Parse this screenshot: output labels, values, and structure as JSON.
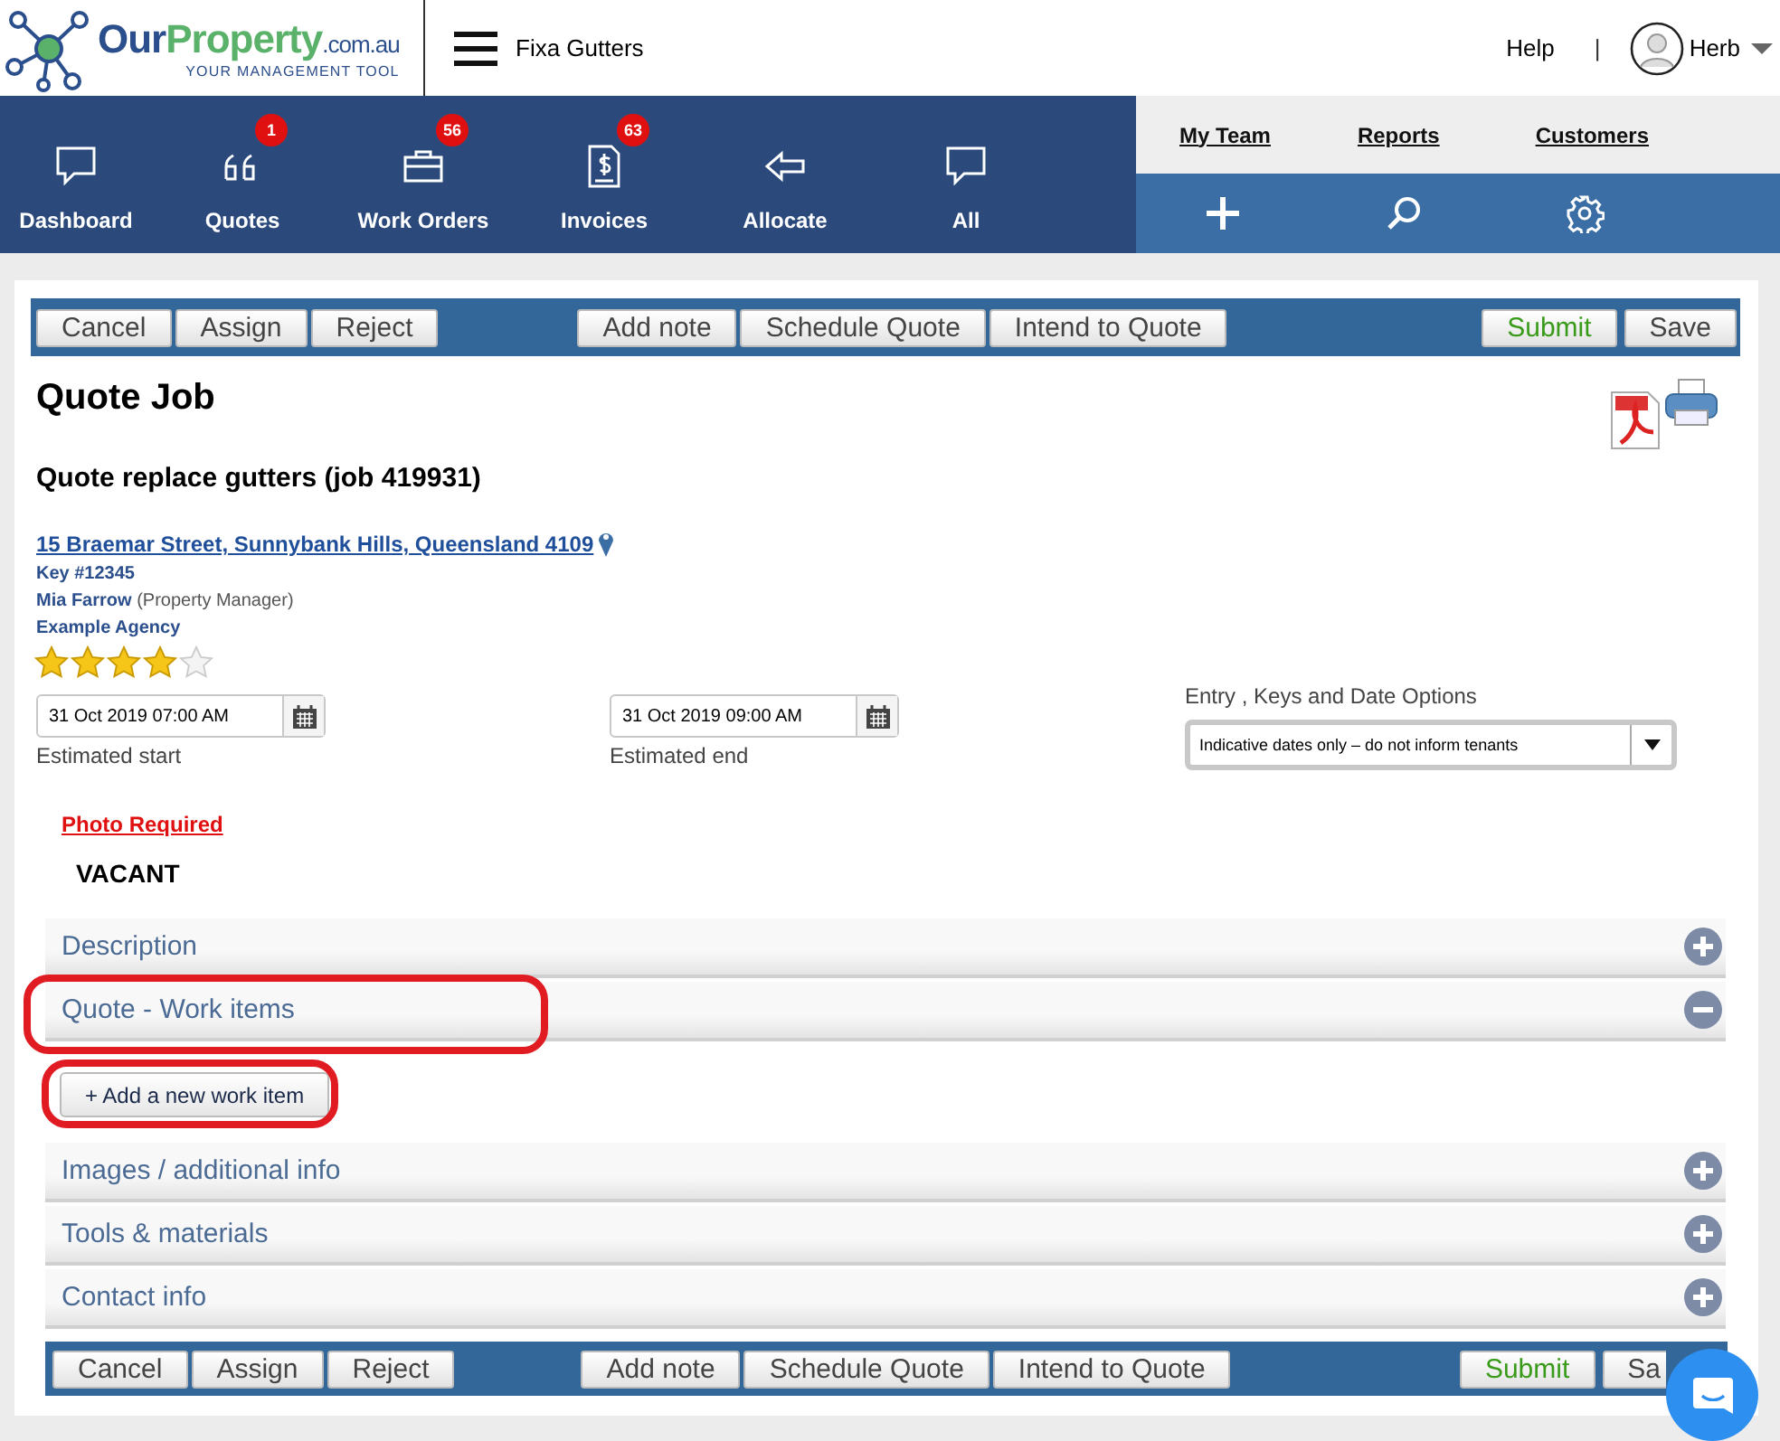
{
  "header": {
    "brand": [
      "Our",
      "Property",
      ".com.au"
    ],
    "tagline": "YOUR MANAGEMENT TOOL",
    "business": "Fixa Gutters",
    "help": "Help",
    "separator": "|",
    "user": "Herb"
  },
  "nav": [
    {
      "label": "Dashboard",
      "kind": "chat"
    },
    {
      "label": "Quotes",
      "kind": "quote",
      "badge": "1"
    },
    {
      "label": "Work Orders",
      "kind": "briefcase",
      "badge": "56"
    },
    {
      "label": "Invoices",
      "kind": "invoice",
      "badge": "63"
    },
    {
      "label": "Allocate",
      "kind": "arrow"
    },
    {
      "label": "All",
      "kind": "chat"
    }
  ],
  "side_links": [
    "My Team",
    "Reports",
    "Customers"
  ],
  "toolbar_top": {
    "left": [
      {
        "label": "Cancel",
        "kind": "plain"
      },
      {
        "label": "Assign",
        "kind": "plain"
      },
      {
        "label": "Reject",
        "kind": "plain"
      }
    ],
    "middle": [
      {
        "label": "Add note",
        "kind": "plain"
      },
      {
        "label": "Schedule Quote",
        "kind": "plain"
      },
      {
        "label": "Intend to Quote",
        "kind": "plain"
      }
    ],
    "right": [
      {
        "label": "Submit",
        "kind": "submit"
      },
      {
        "label": "Save",
        "kind": "plain"
      }
    ]
  },
  "job": {
    "title": "Quote Job",
    "subtitle": "Quote replace gutters (job 419931)",
    "address": "15 Braemar Street, Sunnybank Hills, Queensland 4109",
    "key": "Key #12345",
    "manager": "Mia Farrow",
    "manager_role": "(Property Manager)",
    "agency": "Example Agency",
    "stars": 4
  },
  "dates": [
    {
      "value": "31 Oct 2019 07:00 AM",
      "label": "Estimated start"
    },
    {
      "value": "31 Oct 2019 09:00 AM",
      "label": "Estimated end"
    }
  ],
  "entry_options": {
    "label": "Entry , Keys and Date Options",
    "value": "Indicative dates only – do not inform tenants"
  },
  "photo_required": "Photo Required",
  "occupancy": "VACANT",
  "sections": [
    {
      "title": "Description",
      "expanded": false,
      "highlighted": false
    },
    {
      "title": "Quote - Work items",
      "expanded": true,
      "highlighted": true,
      "add_button": {
        "label": "+ Add a new work item",
        "highlighted": true
      }
    },
    {
      "title": "Images / additional info",
      "expanded": false,
      "highlighted": false
    },
    {
      "title": "Tools & materials",
      "expanded": false,
      "highlighted": false
    },
    {
      "title": "Contact info",
      "expanded": false,
      "highlighted": false
    }
  ],
  "toolbar_bottom": {
    "left": [
      {
        "label": "Cancel",
        "kind": "plain"
      },
      {
        "label": "Assign",
        "kind": "plain"
      },
      {
        "label": "Reject",
        "kind": "plain"
      }
    ],
    "middle": [
      {
        "label": "Add note",
        "kind": "plain"
      },
      {
        "label": "Schedule Quote",
        "kind": "plain"
      },
      {
        "label": "Intend to Quote",
        "kind": "plain"
      }
    ],
    "right": [
      {
        "label": "Submit",
        "kind": "submit"
      },
      {
        "label": "Sa",
        "kind": "cut"
      }
    ]
  }
}
